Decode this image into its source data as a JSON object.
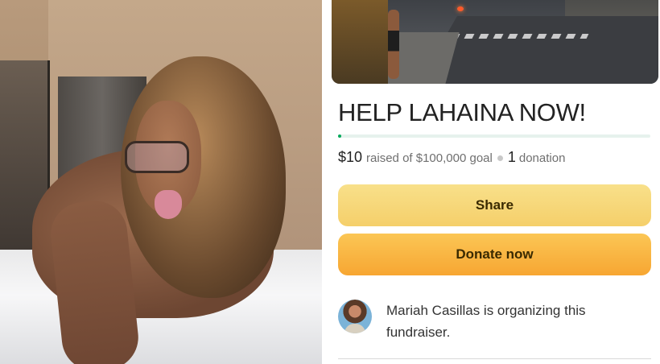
{
  "left_image": {
    "alt": ""
  },
  "campaign": {
    "title": "HELP LAHAINA NOW!",
    "progress_fraction": 0.0001
  },
  "stats": {
    "amount_raised": "$10",
    "raised_text": "raised of $100,000 goal",
    "donation_count": "1",
    "donation_label": "donation"
  },
  "buttons": {
    "share_label": "Share",
    "donate_label": "Donate now"
  },
  "organizer": {
    "text": "Mariah Casillas is organizing this fundraiser."
  },
  "colors": {
    "progress": "#02a95c",
    "share_button": "#f5cf6a",
    "donate_button": "#f7a632",
    "title_text": "#222222"
  }
}
